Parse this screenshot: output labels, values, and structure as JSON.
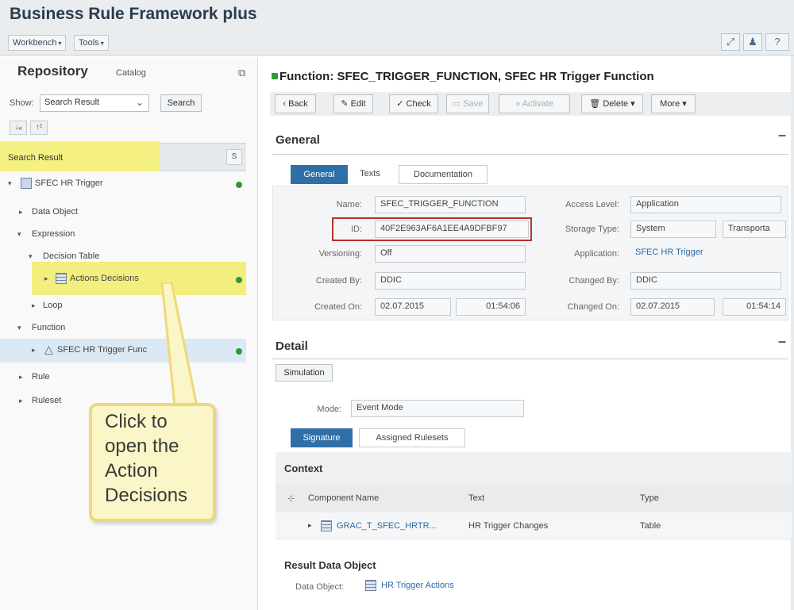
{
  "app": {
    "title": "Business Rule Framework plus"
  },
  "menu": {
    "workbench": "Workbench",
    "tools": "Tools"
  },
  "left": {
    "repository": "Repository",
    "catalog": "Catalog",
    "show_label": "Show:",
    "show_value": "Search Result",
    "search_button": "Search",
    "tree_root": "Search Result",
    "tree_s": "S",
    "tree": [
      {
        "label": "SFEC HR Trigger"
      },
      {
        "label": "Data Object"
      },
      {
        "label": "Expression"
      },
      {
        "label": "Decision Table"
      },
      {
        "label": "Actions Decisions"
      },
      {
        "label": "Loop"
      },
      {
        "label": "Function"
      },
      {
        "label": "SFEC HR Trigger Func"
      },
      {
        "label": "Rule"
      },
      {
        "label": "Ruleset"
      }
    ]
  },
  "callout": {
    "text": "Click to open the Action Decisions"
  },
  "right": {
    "function_title": "Function: SFEC_TRIGGER_FUNCTION, SFEC HR Trigger Function",
    "toolbar": {
      "back": "Back",
      "edit": "Edit",
      "check": "Check",
      "save": "Save",
      "activate": "Activate",
      "delete": "Delete",
      "more": "More"
    },
    "general": {
      "title": "General",
      "tabs": [
        "General",
        "Texts",
        "Documentation"
      ],
      "name_label": "Name:",
      "name_value": "SFEC_TRIGGER_FUNCTION",
      "id_label": "ID:",
      "id_value": "40F2E963AF6A1EE4A9DFBF97",
      "versioning_label": "Versioning:",
      "versioning_value": "Off",
      "created_by_label": "Created By:",
      "created_by_value": "DDIC",
      "created_on_label": "Created On:",
      "created_on_date": "02.07.2015",
      "created_on_time": "01:54:06",
      "access_level_label": "Access Level:",
      "access_level_value": "Application",
      "storage_type_label": "Storage Type:",
      "storage_type_value": "System",
      "storage_type_extra": "Transporta",
      "application_label": "Application:",
      "application_value": "SFEC HR Trigger",
      "changed_by_label": "Changed By:",
      "changed_by_value": "DDIC",
      "changed_on_label": "Changed On:",
      "changed_on_date": "02.07.2015",
      "changed_on_time": "01:54:14"
    },
    "detail": {
      "title": "Detail",
      "simulation": "Simulation",
      "mode_label": "Mode:",
      "mode_value": "Event Mode",
      "tabs": [
        "Signature",
        "Assigned Rulesets"
      ],
      "context_title": "Context",
      "columns": [
        "Component Name",
        "Text",
        "Type"
      ],
      "row": {
        "name": "GRAC_T_SFEC_HRTR...",
        "text": "HR Trigger Changes",
        "type": "Table"
      },
      "result_title": "Result Data Object",
      "data_object_label": "Data Object:",
      "data_object_value": "HR Trigger Actions"
    }
  },
  "colors": {
    "accent": "#2e6fa8",
    "highlight": "#f4f082",
    "status_active": "#2f9a3a",
    "id_outline": "#b5322d"
  }
}
